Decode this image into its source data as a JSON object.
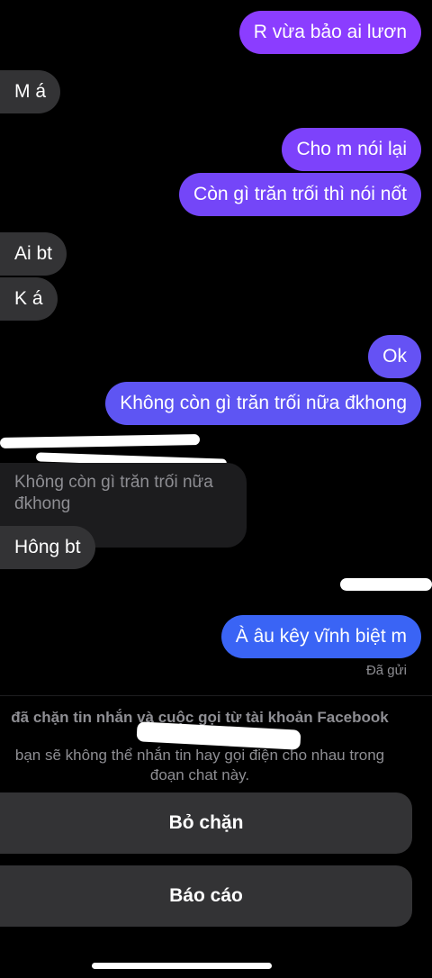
{
  "colors": {
    "sent_gradient_top": "#8b3dff",
    "sent_gradient_mid": "#6a4cf5",
    "sent_gradient_bottom": "#3a64f5",
    "received_bubble": "#333335",
    "muted_text": "#8e8e93",
    "button_bg": "#333335"
  },
  "messages": [
    {
      "side": "sent",
      "text": "R vừa bảo ai lươn"
    },
    {
      "side": "received",
      "text": "M á"
    },
    {
      "side": "sent",
      "text": "Cho m nói lại"
    },
    {
      "side": "sent",
      "text": "Còn gì trăn trối thì nói nốt"
    },
    {
      "side": "received",
      "text": "Ai bt"
    },
    {
      "side": "received",
      "text": "K á"
    },
    {
      "side": "sent",
      "text": "Ok"
    },
    {
      "side": "sent",
      "text": "Không còn gì trăn trối nữa đkhong"
    },
    {
      "side": "received",
      "text": "Hông bt"
    },
    {
      "side": "sent",
      "text": "À âu kêy vĩnh biệt m"
    }
  ],
  "reply": {
    "quoted_text": "Không còn gì trăn trối nữa đkhong"
  },
  "status": {
    "sent_label": "Đã gửi"
  },
  "block_notice": {
    "title": "đã chặn tin nhắn và cuộc gọi từ tài khoản Facebook của",
    "subtitle": "bạn sẽ không thể nhắn tin hay gọi điện cho nhau trong đoạn chat này."
  },
  "actions": {
    "unblock_label": "Bỏ chặn",
    "report_label": "Báo cáo"
  }
}
